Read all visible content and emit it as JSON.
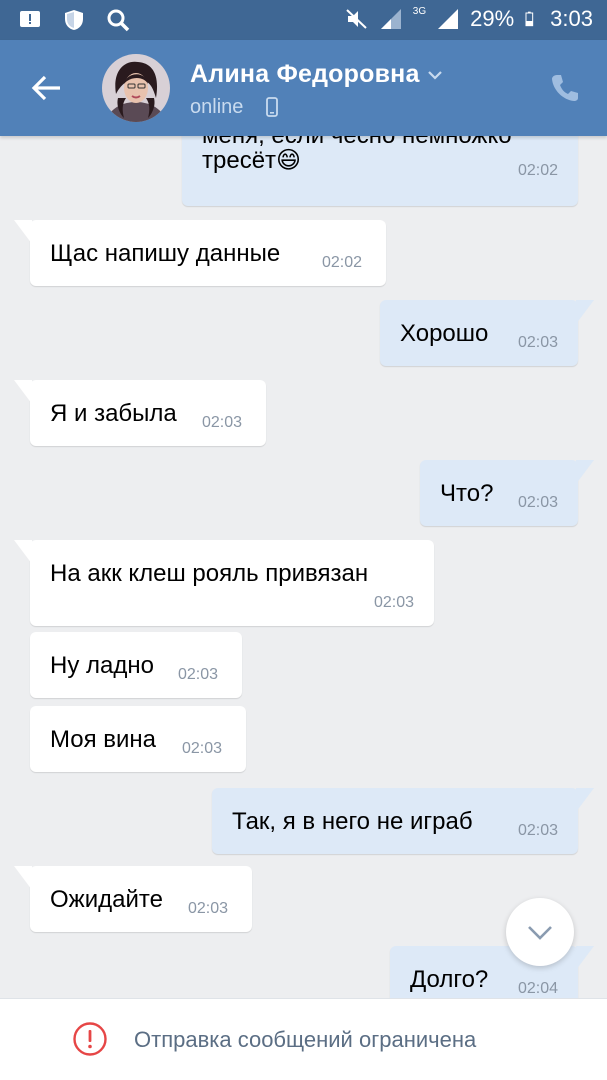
{
  "status_bar": {
    "battery": "29%",
    "time": "3:03",
    "network": "3G",
    "icons": [
      "notification-icon",
      "shield-icon",
      "search-icon",
      "mute-icon",
      "signal-icon",
      "battery-icon"
    ]
  },
  "header": {
    "name": "Алина Федоровна",
    "status": "online",
    "icons": [
      "back-arrow-icon",
      "chevron-down-icon",
      "mobile-phone-icon",
      "call-icon"
    ]
  },
  "messages": [
    {
      "dir": "out",
      "text_line1": "меня, если чесно немножко",
      "text_line2": "тресёт😄",
      "time": "02:02"
    },
    {
      "dir": "in",
      "text": "Щас напишу данные",
      "time": "02:02"
    },
    {
      "dir": "out",
      "text": "Хорошо",
      "time": "02:03"
    },
    {
      "dir": "in",
      "text": "Я и забыла",
      "time": "02:03"
    },
    {
      "dir": "out",
      "text": "Что?",
      "time": "02:03"
    },
    {
      "dir": "in",
      "text": "На акк клеш рояль привязан",
      "time": "02:03"
    },
    {
      "dir": "in",
      "text": "Ну ладно",
      "time": "02:03"
    },
    {
      "dir": "in",
      "text": "Моя вина",
      "time": "02:03"
    },
    {
      "dir": "out",
      "text": "Так, я в него не играб",
      "time": "02:03"
    },
    {
      "dir": "in",
      "text": "Ожидайте",
      "time": "02:03"
    },
    {
      "dir": "out",
      "text": "Долго?",
      "time": "02:04"
    }
  ],
  "bottom": {
    "restriction": "Отправка сообщений ограничена"
  },
  "colors": {
    "header": "#5181b8",
    "status_bar": "#3f6794",
    "chat_bg": "#edeef0",
    "out_bubble": "#dde9f7",
    "in_bubble": "#ffffff",
    "warning": "#e64646"
  }
}
